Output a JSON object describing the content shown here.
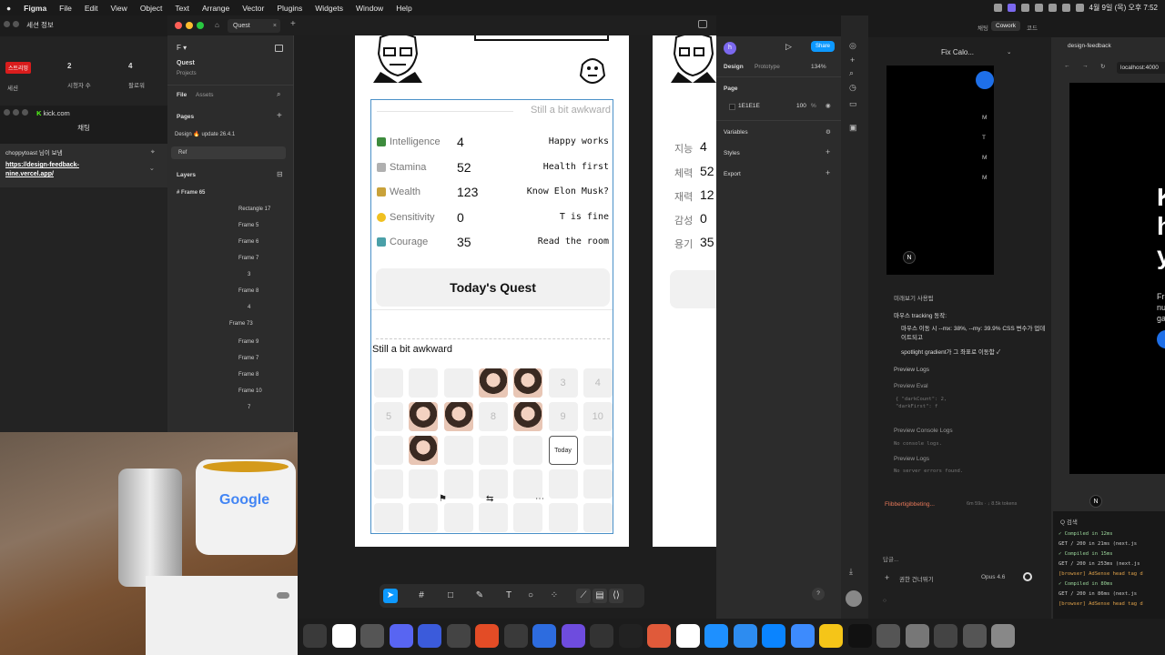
{
  "menubar": {
    "app": "Figma",
    "items": [
      "File",
      "Edit",
      "View",
      "Object",
      "Text",
      "Arrange",
      "Vector",
      "Plugins",
      "Widgets",
      "Window",
      "Help"
    ],
    "clock": "4월 9일 (목) 오후 7:52"
  },
  "leftpanel": {
    "session_title": "세션 정보",
    "live_badge": "스트리밍",
    "stat_session_label": "세션",
    "viewers_value": "2",
    "viewers_label": "시청자 수",
    "followers_value": "4",
    "followers_label": "팔로워",
    "kick_title": "kick.com",
    "chat_label": "채팅",
    "chat_user": "choppytoast 님이 보냄",
    "chat_link": "https://design-feedback-nine.vercel.app/"
  },
  "figma": {
    "tab_dashboard": "dashboard.kk",
    "tab_quest": "Quest",
    "project_name": "Quest",
    "project_sub": "Projects",
    "file_tab": "File",
    "assets_tab": "Assets",
    "pages_header": "Pages",
    "pages": [
      "Design 🔥 update 26.4.1",
      "Ref"
    ],
    "layers_header": "Layers",
    "frame_root": "Frame 65",
    "layers": [
      "Rectangle 17",
      "Frame 5",
      "Frame 6",
      "Frame 7",
      "3",
      "Frame 8",
      "4",
      "Frame 73",
      "Frame 9",
      "Frame 7",
      "Frame 8",
      "Frame 10",
      "7"
    ],
    "card_subtitle": "Still a bit awkward",
    "stats": [
      {
        "label": "Intelligence",
        "value": "4",
        "quote": "Happy works",
        "color": "#3d8b3d"
      },
      {
        "label": "Stamina",
        "value": "52",
        "quote": "Health first",
        "color": "#b0b0b0"
      },
      {
        "label": "Wealth",
        "value": "123",
        "quote": "Know Elon Musk?",
        "color": "#c9a23a"
      },
      {
        "label": "Sensitivity",
        "value": "0",
        "quote": "T is fine",
        "color": "#f0c020"
      },
      {
        "label": "Courage",
        "value": "35",
        "quote": "Read the room",
        "color": "#4aa0a8"
      }
    ],
    "quest_button": "Today's Quest",
    "calendar_title": "Still a bit awkward",
    "calendar_cells": [
      "",
      "",
      "",
      "face",
      "face",
      "3",
      "4",
      "5",
      "face",
      "face",
      "8",
      "face",
      "9",
      "10",
      "",
      "face",
      "",
      "",
      "",
      "Today",
      "",
      "",
      "",
      "",
      "",
      "",
      "",
      "",
      "",
      "",
      "",
      "",
      "",
      "",
      ""
    ],
    "frame2_labels": [
      "지능",
      "체력",
      "재력",
      "감성",
      "용기"
    ],
    "frame2_values": [
      "4",
      "52",
      "12",
      "0",
      "35"
    ]
  },
  "props": {
    "avatar": "h",
    "share": "Share",
    "design_tab": "Design",
    "prototype_tab": "Prototype",
    "zoom": "134%",
    "page_header": "Page",
    "page_color": "1E1E1E",
    "page_opacity": "100",
    "page_percent": "%",
    "variables": "Variables",
    "styles": "Styles",
    "export": "Export"
  },
  "browser": {
    "tab_title": "design-feedback",
    "address": "localhost:4000",
    "fix_title": "Fix Calo...",
    "cowork": "Cowork",
    "code": "코드",
    "chat": "채팅",
    "hero_letters": [
      "K",
      "h",
      "y"
    ],
    "hero_sub": [
      "Free",
      "num",
      "gain"
    ],
    "list_items": [
      "M",
      "T",
      "M",
      "M"
    ],
    "section_title": "미래보기 사용됨",
    "mouse_tracking": "마우스 tracking 동작:",
    "bullet1": "마우스 이동 시 --mx: 38%, --my: 39.9% CSS 변수가 업데이트되고",
    "bullet2": "spotlight gradient가 그 좌표로 이동함 ✓",
    "preview_logs": "Preview Logs",
    "preview_eval": "Preview Eval",
    "eval_body": "{ \"darkCount\": 2, \"darkFirst\": f",
    "console_logs": "Preview Console Logs",
    "no_console": "No console logs.",
    "server_logs": "Preview Logs",
    "no_server": "No server errors found.",
    "status": "Flibbertigibbeting...",
    "status_meta": "6m 59s · ↓ 8.5k tokens",
    "prompt_placeholder": "답글...",
    "mode": "권한 건너뛰기",
    "model": "Opus 4.6",
    "terminal_title": "Q 검색",
    "terminal_lines": [
      "✓ Compiled in 12ms",
      "  GET / 200 in 21ms (next.js",
      "✓ Compiled in 15ms",
      "  GET / 200 in 253ms (next.js",
      "[browser] AdSense head tag d",
      "✓ Compiled in 80ms",
      "  GET / 200 in 86ms (next.js",
      "[browser] AdSense head tag d"
    ]
  },
  "webcam": {
    "mug_text": "Google"
  },
  "dock": {
    "colors": [
      "#3a3a3a",
      "#fff",
      "#555",
      "#5865f2",
      "#3b5bdb",
      "#444",
      "#e34c26",
      "#3a3a3a",
      "#2d6cdf",
      "#6e4cde",
      "#333",
      "#222",
      "#e05a3a",
      "#fff",
      "#1e90ff",
      "#2d8cf0",
      "#0a84ff",
      "#3d8bfd",
      "#f5c518",
      "#111",
      "#555",
      "#777",
      "#444",
      "#555",
      "#888"
    ]
  }
}
